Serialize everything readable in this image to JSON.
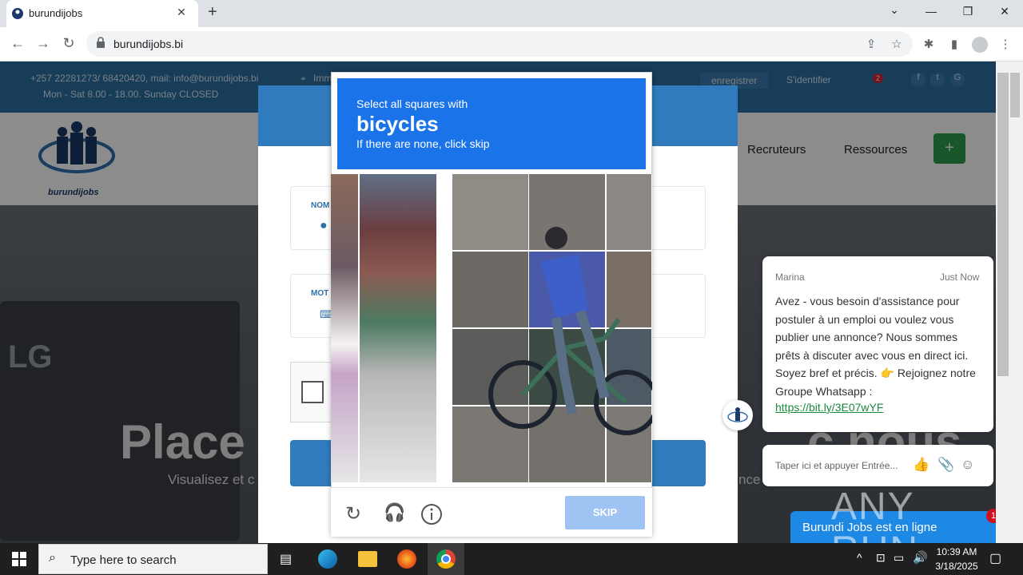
{
  "browser": {
    "tab_title": "burundijobs",
    "url": "burundijobs.bi",
    "new_tab": "+",
    "tab_close": "✕"
  },
  "site": {
    "contact_phone": "+257 22281273/ 68420420, mail: info@burundijobs.bi",
    "hours": "Mon - Sat 8.00 - 18.00. Sunday CLOSED",
    "location_partial": "Imm",
    "register": "enregistrer",
    "login": "S'identifier",
    "notif_count": "2",
    "logo_text": "burundijobs",
    "nav_recruteurs": "Recruteurs",
    "nav_ressources": "Ressources",
    "add_btn": "+",
    "hero_title_left": "Place",
    "hero_title_right": "c nous",
    "hero_sub_left": "Visualisez et c",
    "hero_sub_right": "nce",
    "form_label_nom": "NOM",
    "form_label_mot": "MOT",
    "lg_text": "LG"
  },
  "chat": {
    "agent": "Marina",
    "time": "Just Now",
    "message": "Avez - vous besoin d'assistance pour postuler à un emploi ou voulez vous publier une annonce? Nous sommes prêts à discuter avec vous en direct ici. Soyez bref et précis. 👉 Rejoignez notre Groupe Whatsapp :",
    "link": "https://bit.ly/3E07wYF",
    "input_placeholder": "Taper ici et appuyer Entrée...",
    "status_bar": "Burundi Jobs est en ligne",
    "unread": "1"
  },
  "captcha": {
    "instruction": "Select all squares with",
    "target": "bicycles",
    "hint": "If there are none, click skip",
    "skip_label": "SKIP"
  },
  "watermark": "ANY RUN",
  "taskbar": {
    "search_placeholder": "Type here to search",
    "time": "10:39 AM",
    "date": "3/18/2025"
  }
}
